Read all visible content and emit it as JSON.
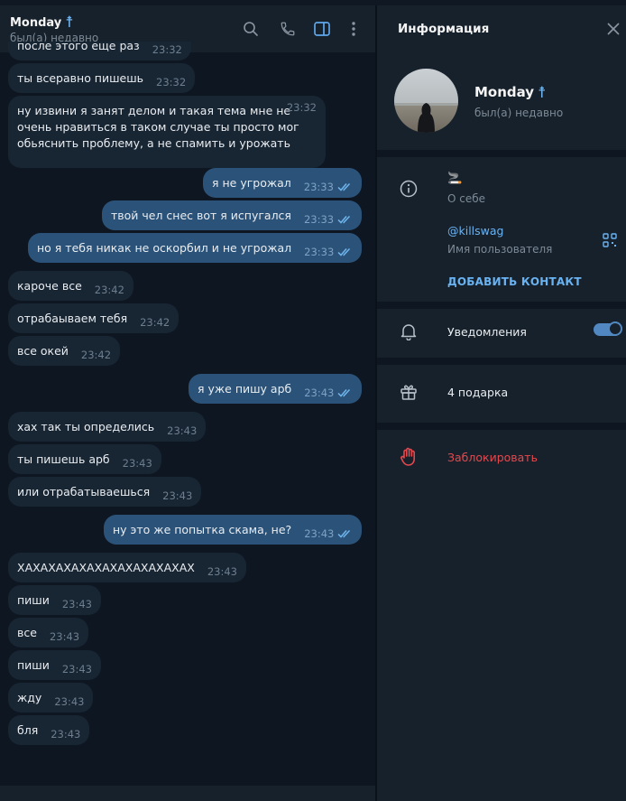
{
  "chat": {
    "name": "Monday",
    "name_symbol": "☨",
    "status": "был(а) недавно",
    "header_icons": [
      "search-icon",
      "phone-icon",
      "sidebar-toggle-icon",
      "more-vertical-icon"
    ],
    "messages": [
      {
        "dir": "in",
        "text": "после этого еще раз",
        "time": "23:32"
      },
      {
        "dir": "in",
        "text": "ты всеравно пишешь",
        "time": "23:32"
      },
      {
        "dir": "in",
        "text": "ну извини я занят делом и такая тема мне не очень нравиться в таком случае ты просто мог обьяснить проблему, а не спамить и урожать",
        "time": "23:32"
      },
      {
        "dir": "out",
        "text": "я не угрожал",
        "time": "23:33"
      },
      {
        "dir": "out",
        "text": "твой чел снес вот я испугался",
        "time": "23:33"
      },
      {
        "dir": "out",
        "text": "но я тебя никак не оскорбил и не угрожал",
        "time": "23:33"
      },
      {
        "dir": "in",
        "text": "кароче все",
        "time": "23:42"
      },
      {
        "dir": "in",
        "text": "отрабаываем тебя",
        "time": "23:42"
      },
      {
        "dir": "in",
        "text": "все окей",
        "time": "23:42"
      },
      {
        "dir": "out",
        "text": "я уже пишу арб",
        "time": "23:43"
      },
      {
        "dir": "in",
        "text": "хах так ты определись",
        "time": "23:43"
      },
      {
        "dir": "in",
        "text": "ты пишешь арб",
        "time": "23:43"
      },
      {
        "dir": "in",
        "text": "или отрабатываешься",
        "time": "23:43"
      },
      {
        "dir": "out",
        "text": "ну это же попытка скама, не?",
        "time": "23:43"
      },
      {
        "dir": "in",
        "text": "ХАХАХАХАХАХАХАХАХАХАХАХ",
        "time": "23:43"
      },
      {
        "dir": "in",
        "text": "пиши",
        "time": "23:43"
      },
      {
        "dir": "in",
        "text": "все",
        "time": "23:43"
      },
      {
        "dir": "in",
        "text": "пиши",
        "time": "23:43"
      },
      {
        "dir": "in",
        "text": "жду",
        "time": "23:43"
      },
      {
        "dir": "in",
        "text": "бля",
        "time": "23:43"
      }
    ]
  },
  "info": {
    "title": "Информация",
    "name": "Monday",
    "name_symbol": "☨",
    "status": "был(а) недавно",
    "bio_emoji": "🚬",
    "bio_label": "О себе",
    "username": "@killswag",
    "username_label": "Имя пользователя",
    "add_contact": "ДОБАВИТЬ КОНТАКТ",
    "notifications": "Уведомления",
    "notifications_on": true,
    "gifts": "4 подарка",
    "block": "Заблокировать"
  },
  "colors": {
    "background": "#0e1621",
    "panel": "#17212b",
    "incoming_bubble": "#182533",
    "outgoing_bubble": "#2b5278",
    "accent": "#6ab3f3",
    "danger": "#e5484d"
  }
}
